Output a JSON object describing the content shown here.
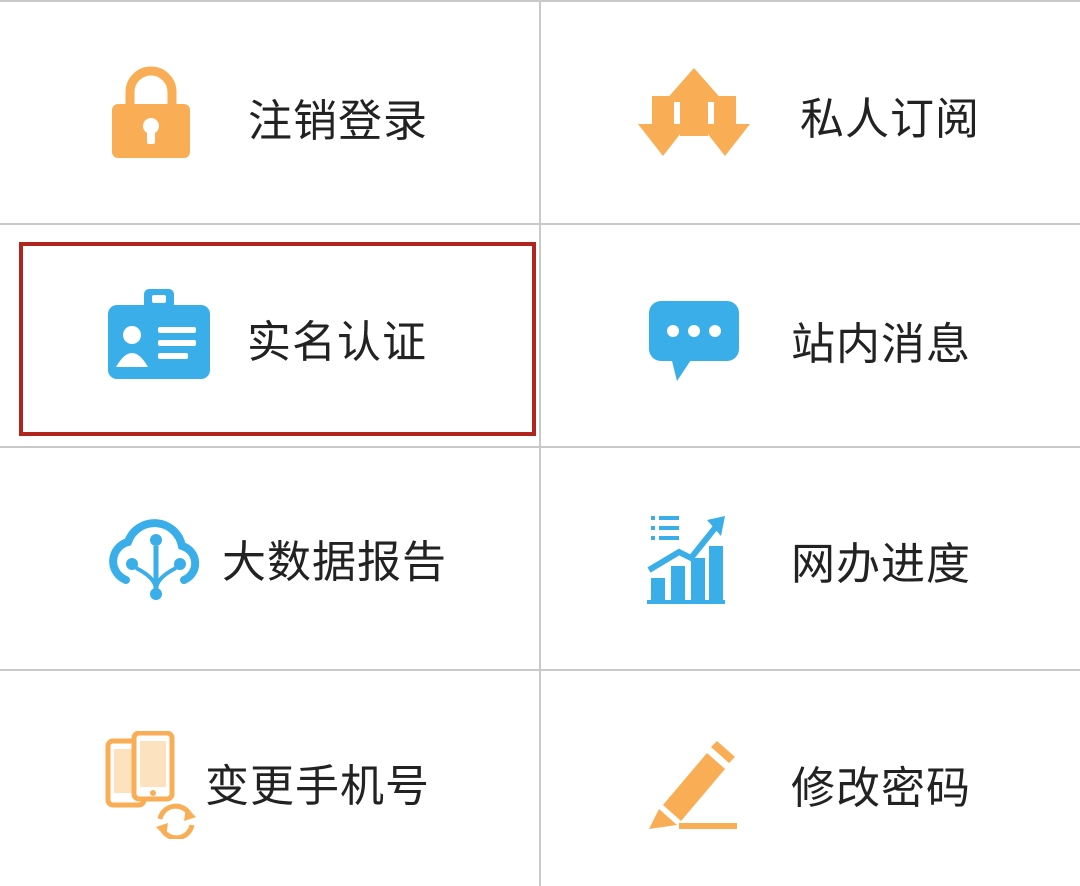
{
  "colors": {
    "orange": "#f9ad55",
    "blue": "#3aaee8",
    "highlight_border": "#b0261f",
    "grid_line": "#c9c9c9"
  },
  "menu": {
    "items": [
      {
        "label": "注销登录",
        "icon": "lock-icon"
      },
      {
        "label": "私人订阅",
        "icon": "subscribe-arrows-icon"
      },
      {
        "label": "实名认证",
        "icon": "id-badge-icon",
        "highlighted": true
      },
      {
        "label": "站内消息",
        "icon": "chat-bubble-icon"
      },
      {
        "label": "大数据报告",
        "icon": "cloud-data-icon"
      },
      {
        "label": "网办进度",
        "icon": "progress-chart-icon"
      },
      {
        "label": "变更手机号",
        "icon": "phone-swap-icon"
      },
      {
        "label": "修改密码",
        "icon": "pencil-icon"
      }
    ]
  }
}
